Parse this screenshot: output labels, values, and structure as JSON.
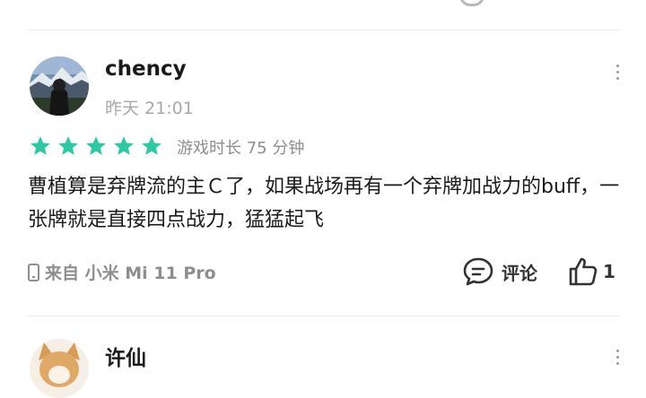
{
  "reviews": [
    {
      "username": "chency",
      "time": "昨天 21:01",
      "rating": 5,
      "playtime": "游戏时长 75 分钟",
      "content": "曹植算是弃牌流的主Ｃ了，如果战场再有一个弃牌加战力的buff，一张牌就是直接四点战力，猛猛起飞",
      "device": "来自 小米 Mi 11 Pro",
      "comment_label": "评论",
      "like_count": "1"
    },
    {
      "username": "许仙"
    }
  ],
  "colors": {
    "star": "#2dc9a0",
    "muted": "#a8a8a8",
    "text": "#1a1a1a"
  },
  "icons": [
    "more-icon",
    "star-icon",
    "phone-icon",
    "comment-icon",
    "thumbs-up-icon"
  ]
}
